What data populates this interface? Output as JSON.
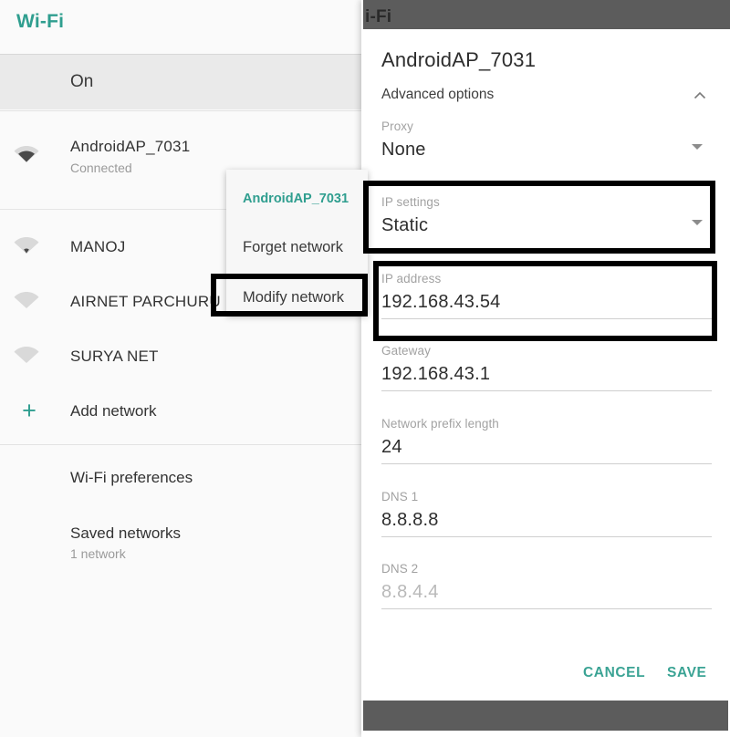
{
  "colors": {
    "accent_teal": "#2f9e8f",
    "button_teal": "#3aa394",
    "dark_bar": "#5c5c5c",
    "highlight_box": "#000000",
    "on_row_bg": "#eaeaea"
  },
  "wifi_screen": {
    "title": "Wi-Fi",
    "toggle_state_label": "On",
    "networks": [
      {
        "name": "AndroidAP_7031",
        "status": "Connected",
        "signal": "full",
        "icon": "wifi-icon"
      },
      {
        "name": "MANOJ",
        "status": "",
        "signal": "low",
        "icon": "wifi-icon"
      },
      {
        "name": "AIRNET PARCHURU",
        "status": "",
        "signal": "none",
        "icon": "wifi-icon"
      },
      {
        "name": "SURYA NET",
        "status": "",
        "signal": "none",
        "icon": "wifi-icon"
      }
    ],
    "add_network": {
      "label": "Add network",
      "icon": "plus-icon"
    },
    "preferences": {
      "label": "Wi-Fi preferences"
    },
    "saved_networks": {
      "label": "Saved networks",
      "sub": "1 network"
    }
  },
  "context_menu": {
    "title": "AndroidAP_7031",
    "items": [
      {
        "label": "Forget network"
      },
      {
        "label": "Modify network",
        "highlighted": true
      }
    ]
  },
  "modify_dialog": {
    "ghost_header_text": "i-Fi",
    "title": "AndroidAP_7031",
    "advanced_options": {
      "label": "Advanced options",
      "icon": "chevron-up-icon",
      "expanded": true
    },
    "fields": [
      {
        "key": "proxy",
        "label": "Proxy",
        "value": "None",
        "type": "dropdown",
        "placeholder": false
      },
      {
        "key": "ip_settings",
        "label": "IP settings",
        "value": "Static",
        "type": "dropdown",
        "placeholder": false
      },
      {
        "key": "ip_address",
        "label": "IP address",
        "value": "192.168.43.54",
        "type": "text",
        "placeholder": false
      },
      {
        "key": "gateway",
        "label": "Gateway",
        "value": "192.168.43.1",
        "type": "text",
        "placeholder": false
      },
      {
        "key": "prefix_len",
        "label": "Network prefix length",
        "value": "24",
        "type": "text",
        "placeholder": false
      },
      {
        "key": "dns1",
        "label": "DNS 1",
        "value": "8.8.8.8",
        "type": "text",
        "placeholder": false
      },
      {
        "key": "dns2",
        "label": "DNS 2",
        "value": "8.8.4.4",
        "type": "text",
        "placeholder": true
      }
    ],
    "actions": {
      "cancel_label": "CANCEL",
      "save_label": "SAVE"
    }
  }
}
